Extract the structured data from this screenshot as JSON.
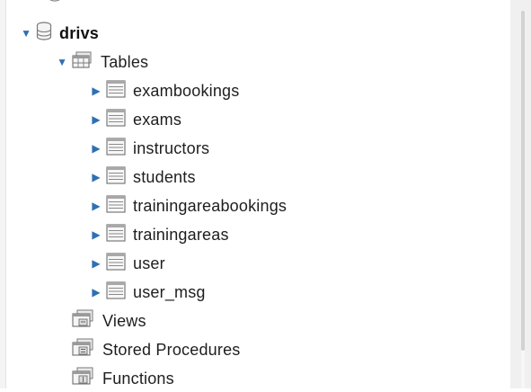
{
  "tree": {
    "schema": {
      "name": "drivs",
      "icon": "database-icon",
      "expanded": true
    },
    "tables_node": {
      "label": "Tables",
      "icon": "table-folder-icon",
      "expanded": true
    },
    "tables": [
      {
        "name": "exambookings",
        "icon": "table-icon"
      },
      {
        "name": "exams",
        "icon": "table-icon"
      },
      {
        "name": "instructors",
        "icon": "table-icon"
      },
      {
        "name": "students",
        "icon": "table-icon"
      },
      {
        "name": "trainingareabookings",
        "icon": "table-icon"
      },
      {
        "name": "trainingareas",
        "icon": "table-icon"
      },
      {
        "name": "user",
        "icon": "table-icon"
      },
      {
        "name": "user_msg",
        "icon": "table-icon"
      }
    ],
    "other_nodes": [
      {
        "label": "Views",
        "icon": "views-icon"
      },
      {
        "label": "Stored Procedures",
        "icon": "stored-procedures-icon"
      },
      {
        "label": "Functions",
        "icon": "functions-icon"
      }
    ]
  },
  "colors": {
    "arrow": "#2f6fb4",
    "text": "#1e1e1e",
    "icon_outline": "#7a7a7a"
  }
}
